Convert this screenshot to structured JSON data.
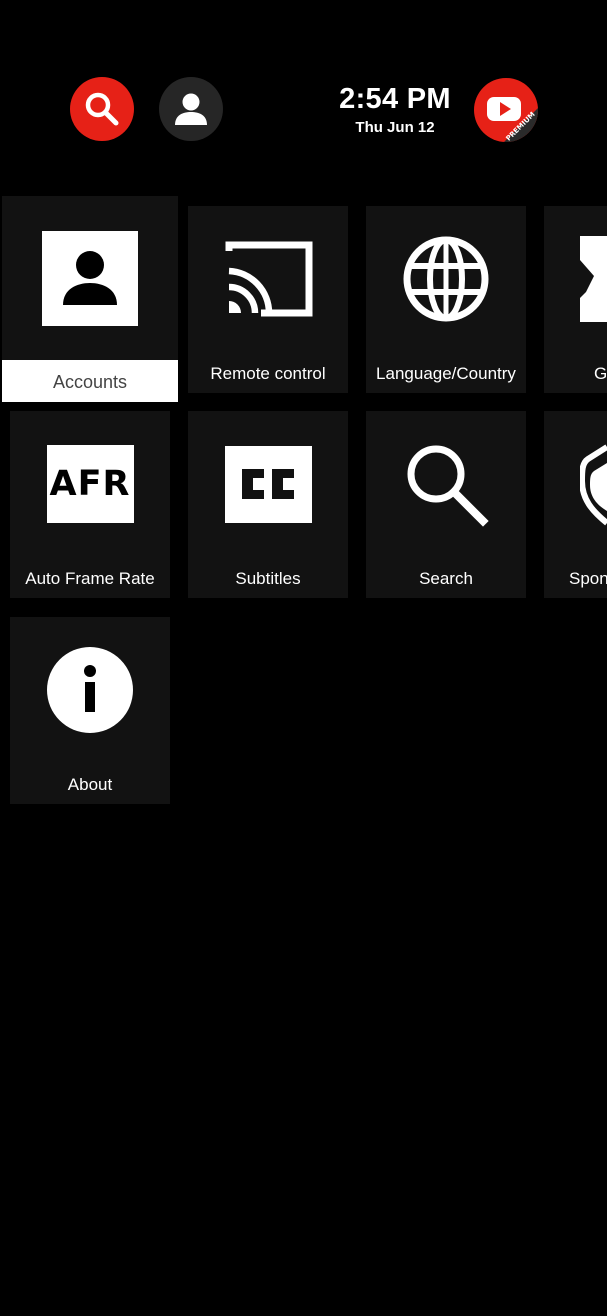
{
  "header": {
    "time": "2:54 PM",
    "date": "Thu Jun 12",
    "search_icon": "search-icon",
    "account_icon": "account-icon",
    "brand_icon": "youtube-premium-icon",
    "brand_badge": "PREMIUM"
  },
  "colors": {
    "accent_red": "#e62117",
    "tile_bg": "#121212",
    "background": "#000000"
  },
  "tiles": [
    {
      "label": "Accounts",
      "icon": "person-icon",
      "selected": true
    },
    {
      "label": "Remote control",
      "icon": "cast-icon"
    },
    {
      "label": "Language/Country",
      "icon": "globe-icon"
    },
    {
      "label": "G",
      "icon": "puzzle-icon"
    },
    {
      "label": "Auto Frame Rate",
      "icon": "afr-icon",
      "icon_text": "AFR"
    },
    {
      "label": "Subtitles",
      "icon": "cc-icon"
    },
    {
      "label": "Search",
      "icon": "search-icon"
    },
    {
      "label": "Spon",
      "icon": "shield-icon"
    },
    {
      "label": "About",
      "icon": "info-icon"
    }
  ]
}
